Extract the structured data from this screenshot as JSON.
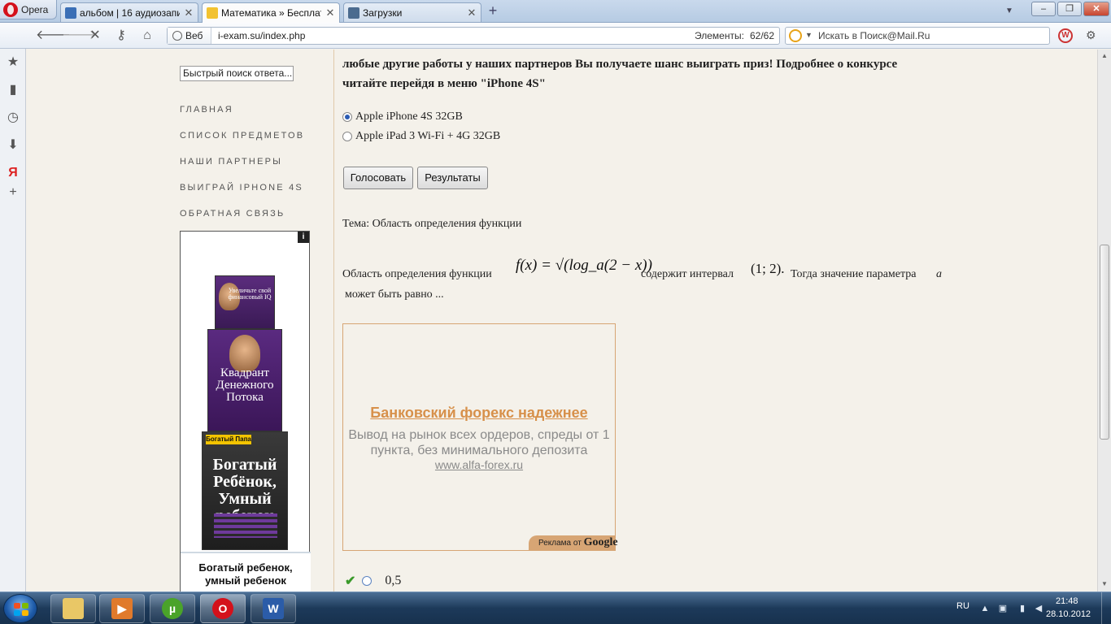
{
  "browser": {
    "menu_label": "Opera",
    "tabs": [
      {
        "label": "альбом | 16 аудиозапи...",
        "icon": "play-icon"
      },
      {
        "label": "Математика » Бесплат...",
        "icon": "envelope-icon"
      },
      {
        "label": "Загрузки",
        "icon": "downloads-icon"
      }
    ],
    "web_chip": "Веб",
    "url": "i-exam.su/index.php",
    "elements_label": "Элементы:",
    "elements_count": "62/62",
    "search_placeholder": "Искать в Поиск@Mail.Ru"
  },
  "sidebar": {
    "quick_search_value": "Быстрый поиск ответа...",
    "menu": [
      "ГЛАВНАЯ",
      "СПИСОК ПРЕДМЕТОВ",
      "НАШИ ПАРТНЕРЫ",
      "ВЫИГРАЙ IPHONE 4S",
      "ОБРАТНАЯ СВЯЗЬ"
    ],
    "ad": {
      "info_label": "i",
      "book1_title": "Увеличьте свой финансовый IQ",
      "book2_title": "Квадрант Денежного Потока",
      "book3_series": "Богатый Папа",
      "book3_title": "Богатый Ребёнок, Умный ребенок",
      "caption": "Богатый ребенок, умный ребенок"
    }
  },
  "main": {
    "intro": "любые другие работы у наших партнеров Вы получаете шанс выиграть приз! Подробнее о конкурсе читайте перейдя в меню \"iPhone 4S\"",
    "poll_options": [
      {
        "label": "Apple iPhone 4S 32GB",
        "checked": true
      },
      {
        "label": "Apple iPad 3 Wi-Fi + 4G 32GB",
        "checked": false
      }
    ],
    "vote_button": "Голосовать",
    "results_button": "Результаты",
    "topic": "Тема: Область определения функции",
    "task": {
      "part1": "Область определения функции",
      "part2": "содержит интервал",
      "part3": "Тогда значение параметра",
      "param": "a",
      "part4": "может быть равно ...",
      "formula": "f(x) = √(log_a(2 − x))",
      "interval": "(1;  2)."
    },
    "google_ad": {
      "title": "Банковский форекс надежнее",
      "body": "Вывод на рынок всех ордеров, спреды от 1 пункта, без минимального депозита",
      "url": "www.alfa-forex.ru",
      "badge_prefix": "Реклама от",
      "badge_brand": "Google"
    },
    "answer": "0,5"
  },
  "taskbar": {
    "language": "RU",
    "time": "21:48",
    "date": "28.10.2012"
  },
  "colors": {
    "page_bg": "#f4f1ea",
    "ad_title": "#d7904a",
    "ad_border": "#d7a574",
    "taskbar": "#1d3a5a"
  }
}
